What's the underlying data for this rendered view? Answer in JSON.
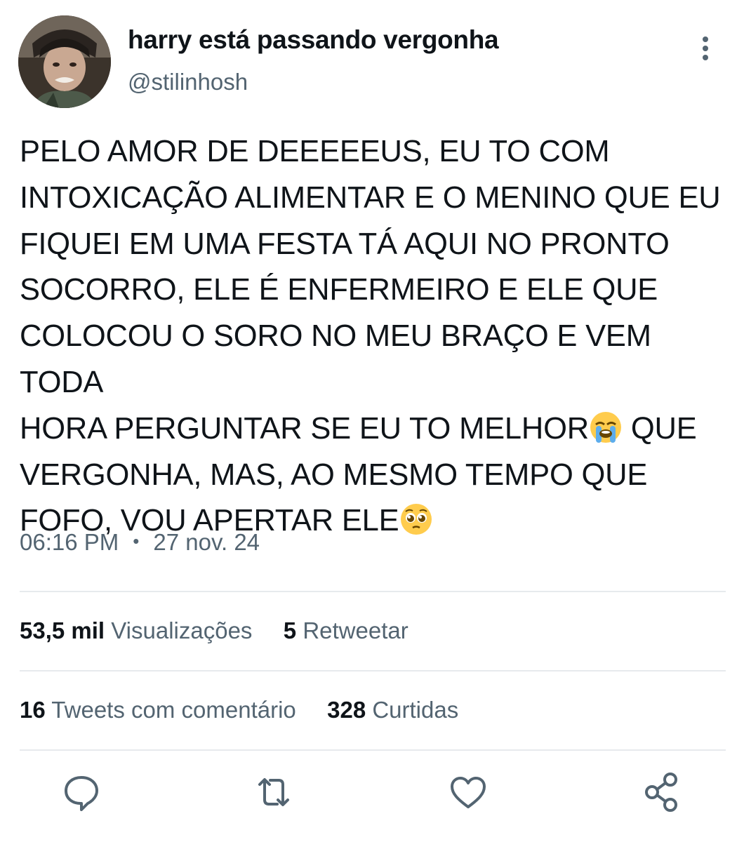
{
  "author": {
    "display_name": "harry está passando vergonha",
    "handle": "@stilinhosh",
    "avatar_icon": "profile-photo"
  },
  "tweet": {
    "lines": [
      "PELO AMOR DE DEEEEEUS, EU TO COM",
      "INTOXICAÇÃO ALIMENTAR E O MENINO QUE EU",
      "FIQUEI EM UMA FESTA TÁ AQUI NO PRONTO",
      "SOCORRO, ELE É ENFERMEIRO E ELE QUE",
      "COLOCOU O SORO NO MEU BRAÇO E VEM TODA",
      "HORA PERGUNTAR SE EU TO MELHOR",
      " QUE",
      "VERGONHA, MAS, AO MESMO TEMPO QUE",
      "FOFO, VOU APERTAR ELE"
    ],
    "emojis": [
      "loudly-crying-face",
      "pleading-face"
    ]
  },
  "meta": {
    "time": "06:16 PM",
    "separator": "•",
    "date": "27 nov. 24"
  },
  "stats": {
    "views_count": "53,5 mil",
    "views_label": "Visualizações",
    "retweets_count": "5",
    "retweets_label": "Retweetar",
    "quotes_count": "16",
    "quotes_label": "Tweets com comentário",
    "likes_count": "328",
    "likes_label": "Curtidas"
  },
  "actions": [
    "reply-icon",
    "retweet-icon",
    "like-icon",
    "share-icon"
  ],
  "colors": {
    "text_primary": "#0f1419",
    "text_secondary": "#536471",
    "divider": "#e7eaed"
  }
}
